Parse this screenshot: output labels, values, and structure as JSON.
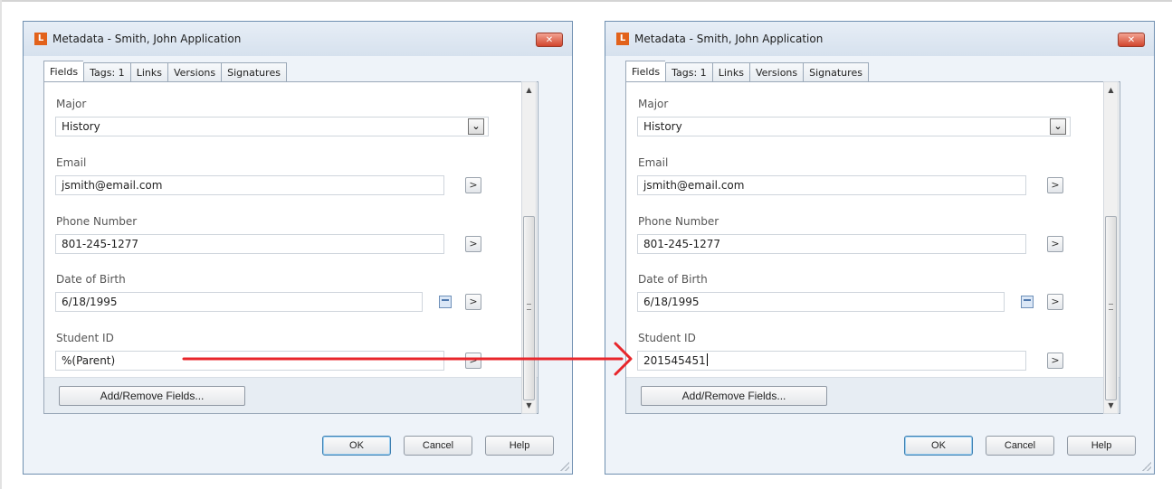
{
  "dialogs": [
    {
      "title": "Metadata - Smith, John Application",
      "app_icon": "L",
      "close_glyph": "✕",
      "tabs": [
        {
          "label": "Fields"
        },
        {
          "label": "Tags: 1"
        },
        {
          "label": "Links"
        },
        {
          "label": "Versions"
        },
        {
          "label": "Signatures"
        }
      ],
      "fields": {
        "major": {
          "label": "Major",
          "value": "History"
        },
        "email": {
          "label": "Email",
          "value": "jsmith@email.com"
        },
        "phone": {
          "label": "Phone Number",
          "value": "801-245-1277"
        },
        "dob": {
          "label": "Date of Birth",
          "value": "6/18/1995"
        },
        "student_id": {
          "label": "Student ID",
          "value": "%(Parent)"
        }
      },
      "add_remove_label": "Add/Remove Fields...",
      "buttons": {
        "ok": "OK",
        "cancel": "Cancel",
        "help": "Help"
      }
    },
    {
      "title": "Metadata - Smith, John Application",
      "app_icon": "L",
      "close_glyph": "✕",
      "tabs": [
        {
          "label": "Fields"
        },
        {
          "label": "Tags: 1"
        },
        {
          "label": "Links"
        },
        {
          "label": "Versions"
        },
        {
          "label": "Signatures"
        }
      ],
      "fields": {
        "major": {
          "label": "Major",
          "value": "History"
        },
        "email": {
          "label": "Email",
          "value": "jsmith@email.com"
        },
        "phone": {
          "label": "Phone Number",
          "value": "801-245-1277"
        },
        "dob": {
          "label": "Date of Birth",
          "value": "6/18/1995"
        },
        "student_id": {
          "label": "Student ID",
          "value": "201545451"
        }
      },
      "add_remove_label": "Add/Remove Fields...",
      "buttons": {
        "ok": "OK",
        "cancel": "Cancel",
        "help": "Help"
      }
    }
  ],
  "glyphs": {
    "dropdown": "⌄",
    "next": ">",
    "scroll_up": "▲",
    "scroll_down": "▼"
  },
  "colors": {
    "annotation_arrow": "#e8262b",
    "app_icon": "#e2621b",
    "close_button": "#d1452d"
  }
}
